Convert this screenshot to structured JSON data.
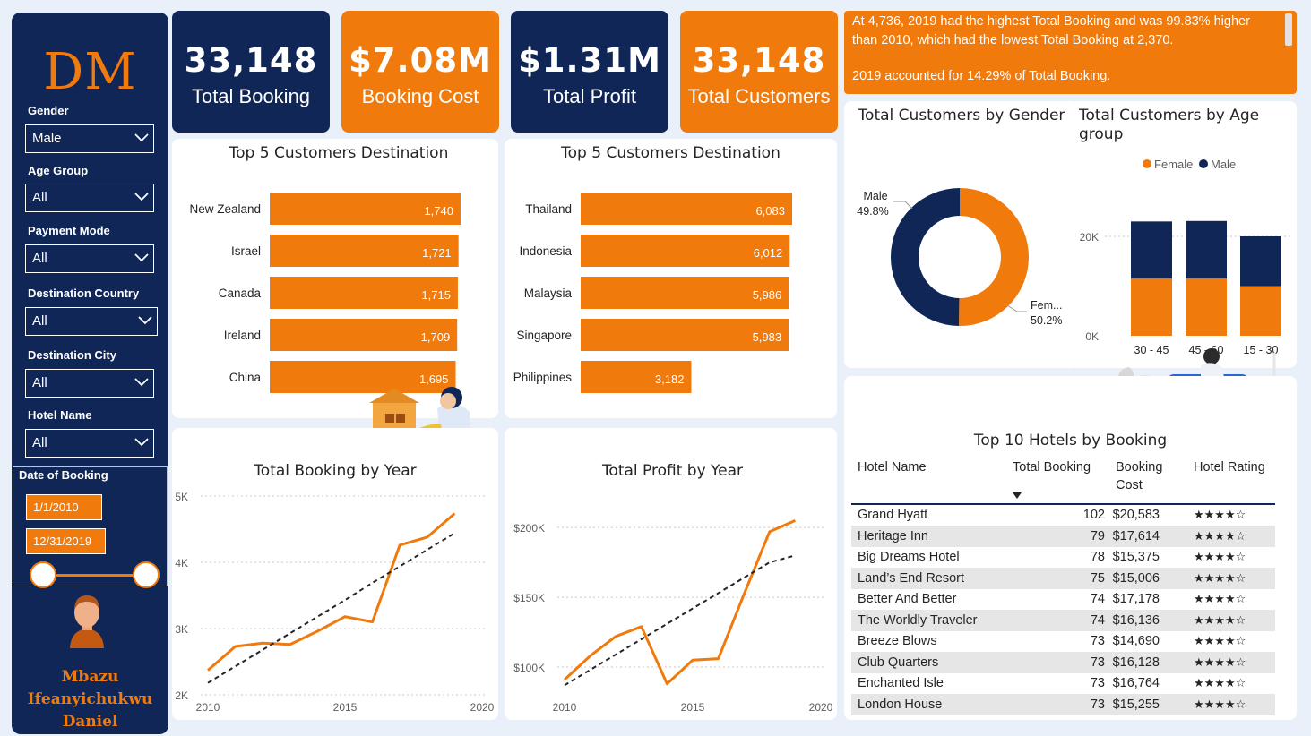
{
  "sidebar": {
    "logo": "DM",
    "filters": [
      {
        "label": "Gender",
        "value": "Male"
      },
      {
        "label": "Age Group",
        "value": "All"
      },
      {
        "label": "Payment Mode",
        "value": "All"
      },
      {
        "label": "Destination Country",
        "value": "All"
      },
      {
        "label": "Destination City",
        "value": "All"
      },
      {
        "label": "Hotel Name",
        "value": "All"
      }
    ],
    "date": {
      "label": "Date of Booking",
      "start": "1/1/2010",
      "end": "12/31/2019"
    },
    "author": [
      "Mbazu",
      "Ifeanyichukwu",
      "Daniel"
    ]
  },
  "kpis": [
    {
      "value": "33,148",
      "label": "Total Booking",
      "color": "#0f2657"
    },
    {
      "value": "$7.08M",
      "label": "Booking Cost",
      "color": "#f07a0c"
    },
    {
      "value": "$1.31M",
      "label": "Total Profit",
      "color": "#0f2657"
    },
    {
      "value": "33,148",
      "label": "Total Customers",
      "color": "#f07a0c"
    }
  ],
  "insight": {
    "line1": "At 4,736, 2019 had the highest Total Booking and was 99.83% higher than 2010, which had the lowest Total Booking at 2,370.",
    "line2": "2019 accounted for 14.29% of Total Booking."
  },
  "colors": {
    "navy": "#0f2657",
    "orange": "#f07a0c"
  },
  "chart_data": [
    {
      "type": "bar",
      "title": "Top 5 Customers Destination",
      "orientation": "horizontal",
      "categories": [
        "New Zealand",
        "Israel",
        "Canada",
        "Ireland",
        "China"
      ],
      "values": [
        1740,
        1721,
        1715,
        1709,
        1695
      ],
      "labels": [
        "1,740",
        "1,721",
        "1,715",
        "1,709",
        "1,695"
      ],
      "color": "#f07a0c"
    },
    {
      "type": "bar",
      "title": "Top 5 Customers Destination",
      "orientation": "horizontal",
      "categories": [
        "Thailand",
        "Indonesia",
        "Malaysia",
        "Singapore",
        "Philippines"
      ],
      "values": [
        6083,
        6012,
        5986,
        5983,
        3182
      ],
      "labels": [
        "6,083",
        "6,012",
        "5,986",
        "5,983",
        "3,182"
      ],
      "color": "#f07a0c"
    },
    {
      "type": "pie",
      "title": "Total Customers by Gender",
      "categories": [
        "Male",
        "Fem..."
      ],
      "values": [
        49.8,
        50.2
      ],
      "labels": [
        "49.8%",
        "50.2%"
      ],
      "colors": [
        "#0f2657",
        "#f07a0c"
      ]
    },
    {
      "type": "bar",
      "stacked": true,
      "title": "Total Customers by Age group",
      "categories": [
        "30 - 45",
        "45 - 60",
        "15 - 30"
      ],
      "series": [
        {
          "name": "Female",
          "values": [
            11500,
            11500,
            10000
          ],
          "color": "#f07a0c"
        },
        {
          "name": "Male",
          "values": [
            11500,
            11600,
            10000
          ],
          "color": "#0f2657"
        }
      ],
      "yticks": [
        "0K",
        "20K"
      ],
      "ylim": [
        0,
        25000
      ],
      "legend": "top"
    },
    {
      "type": "line",
      "title": "Total Booking by Year",
      "x": [
        2010,
        2011,
        2012,
        2013,
        2014,
        2015,
        2016,
        2017,
        2018,
        2019
      ],
      "values": [
        2370,
        2730,
        2780,
        2760,
        2960,
        3180,
        3100,
        4260,
        4380,
        4736
      ],
      "trend": [
        2180,
        2430,
        2680,
        2930,
        3180,
        3430,
        3690,
        3940,
        4190,
        4440
      ],
      "yticks": [
        "2K",
        "3K",
        "4K",
        "5K"
      ],
      "xticks": [
        "2010",
        "2015",
        "2020"
      ],
      "ylim": [
        2000,
        5000
      ],
      "xlim": [
        2010,
        2020
      ]
    },
    {
      "type": "line",
      "title": "Total Profit by Year",
      "x": [
        2010,
        2011,
        2012,
        2013,
        2014,
        2015,
        2016,
        2017,
        2018,
        2019
      ],
      "values": [
        91000,
        108000,
        122000,
        129000,
        88000,
        105000,
        106000,
        152000,
        197000,
        205000
      ],
      "trend": [
        87000,
        98000,
        109000,
        120000,
        131000,
        142000,
        153000,
        164000,
        175000,
        180000
      ],
      "yticks": [
        "$100K",
        "$150K",
        "$200K"
      ],
      "xticks": [
        "2010",
        "2015",
        "2020"
      ],
      "ylim": [
        75000,
        220000
      ],
      "xlim": [
        2010,
        2020
      ]
    }
  ],
  "hotels": {
    "title": "Top 10 Hotels by Booking",
    "columns": [
      "Hotel Name",
      "Total Booking",
      "Booking Cost",
      "Hotel Rating"
    ],
    "rows": [
      [
        "Grand Hyatt",
        "102",
        "$20,583",
        "★★★★☆"
      ],
      [
        "Heritage Inn",
        "79",
        "$17,614",
        "★★★★☆"
      ],
      [
        "Big Dreams Hotel",
        "78",
        "$15,375",
        "★★★★☆"
      ],
      [
        "Land’s End Resort",
        "75",
        "$15,006",
        "★★★★☆"
      ],
      [
        "Better And Better",
        "74",
        "$17,178",
        "★★★★☆"
      ],
      [
        "The Worldly Traveler",
        "74",
        "$16,136",
        "★★★★☆"
      ],
      [
        "Breeze Blows",
        "73",
        "$14,690",
        "★★★★☆"
      ],
      [
        "Club Quarters",
        "73",
        "$16,128",
        "★★★★☆"
      ],
      [
        "Enchanted Isle",
        "73",
        "$16,764",
        "★★★★☆"
      ],
      [
        "London House",
        "73",
        "$15,255",
        "★★★★☆"
      ]
    ]
  }
}
